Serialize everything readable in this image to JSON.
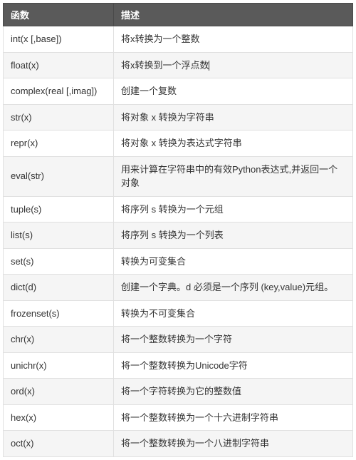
{
  "table": {
    "headers": [
      "函数",
      "描述"
    ],
    "rows": [
      {
        "fn": "int(x [,base])",
        "desc": "将x转换为一个整数"
      },
      {
        "fn": "float(x)",
        "desc": "将x转换到一个浮点数"
      },
      {
        "fn": "complex(real [,imag])",
        "desc": "创建一个复数"
      },
      {
        "fn": "str(x)",
        "desc": "将对象 x 转换为字符串"
      },
      {
        "fn": "repr(x)",
        "desc": "将对象 x 转换为表达式字符串"
      },
      {
        "fn": "eval(str)",
        "desc": "用来计算在字符串中的有效Python表达式,并返回一个对象"
      },
      {
        "fn": "tuple(s)",
        "desc": "将序列 s 转换为一个元组"
      },
      {
        "fn": "list(s)",
        "desc": "将序列 s 转换为一个列表"
      },
      {
        "fn": "set(s)",
        "desc": "转换为可变集合"
      },
      {
        "fn": "dict(d)",
        "desc": "创建一个字典。d 必须是一个序列 (key,value)元组。"
      },
      {
        "fn": "frozenset(s)",
        "desc": "转换为不可变集合"
      },
      {
        "fn": "chr(x)",
        "desc": "将一个整数转换为一个字符"
      },
      {
        "fn": "unichr(x)",
        "desc": "将一个整数转换为Unicode字符"
      },
      {
        "fn": "ord(x)",
        "desc": "将一个字符转换为它的整数值"
      },
      {
        "fn": "hex(x)",
        "desc": "将一个整数转换为一个十六进制字符串"
      },
      {
        "fn": "oct(x)",
        "desc": "将一个整数转换为一个八进制字符串"
      }
    ],
    "cursor_row_index": 1
  }
}
